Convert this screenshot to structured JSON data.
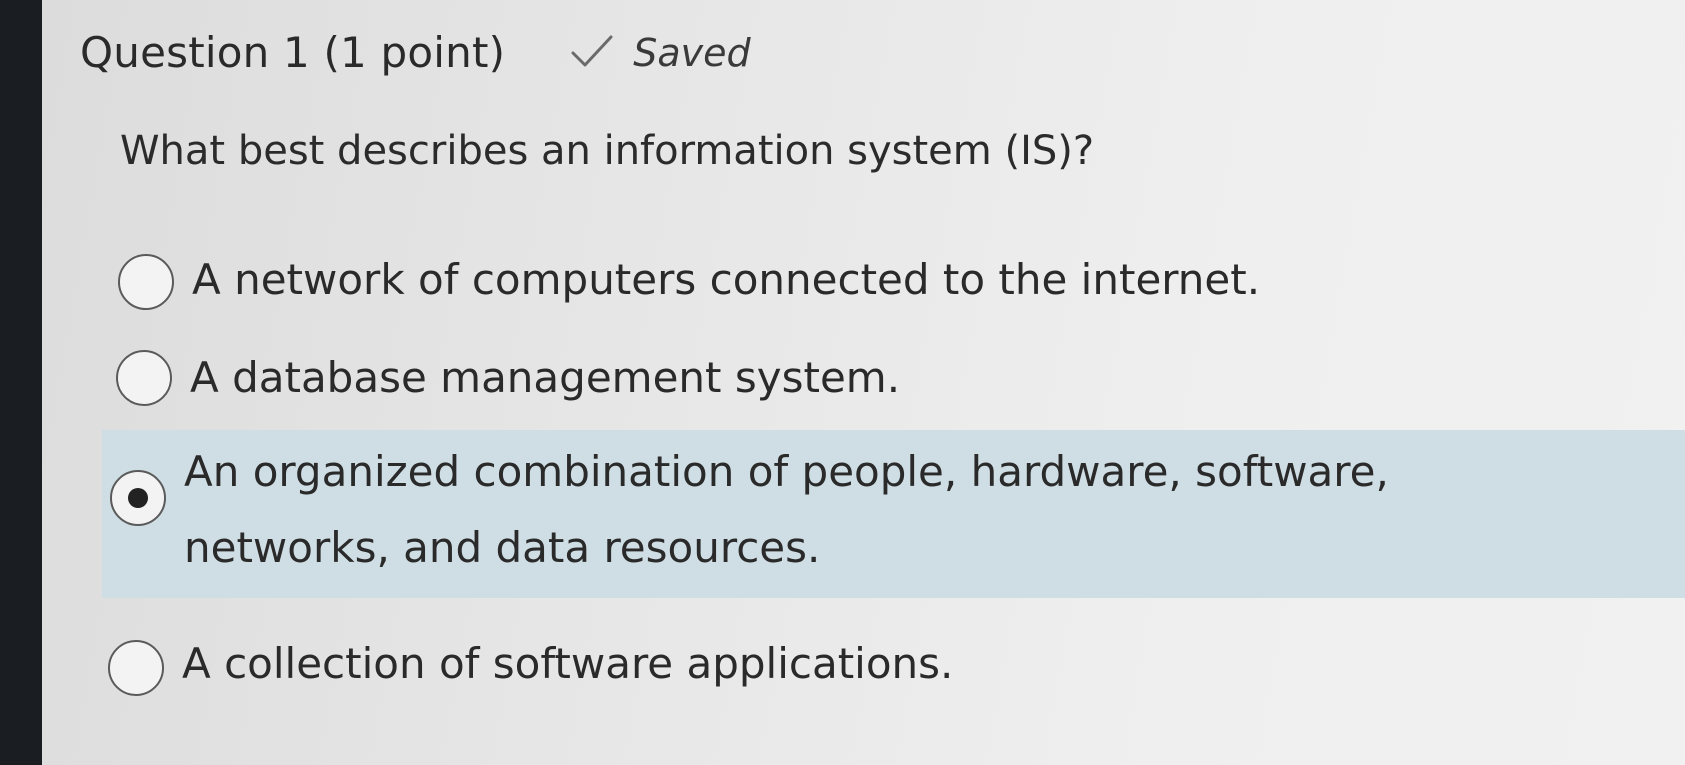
{
  "question": {
    "title": "Question 1 (1 point)",
    "status": "Saved",
    "status_icon": "check-icon",
    "prompt": "What best describes an information system (IS)?"
  },
  "options": [
    {
      "label": "A network of computers connected to the internet.",
      "selected": false
    },
    {
      "label": "A database management system.",
      "selected": false
    },
    {
      "label": "An organized combination of people, hardware, software, networks, and data resources.",
      "selected": true
    },
    {
      "label": "A collection of software applications.",
      "selected": false
    }
  ],
  "colors": {
    "selected_highlight": "#cfdee4",
    "text": "#2a2a2a"
  }
}
